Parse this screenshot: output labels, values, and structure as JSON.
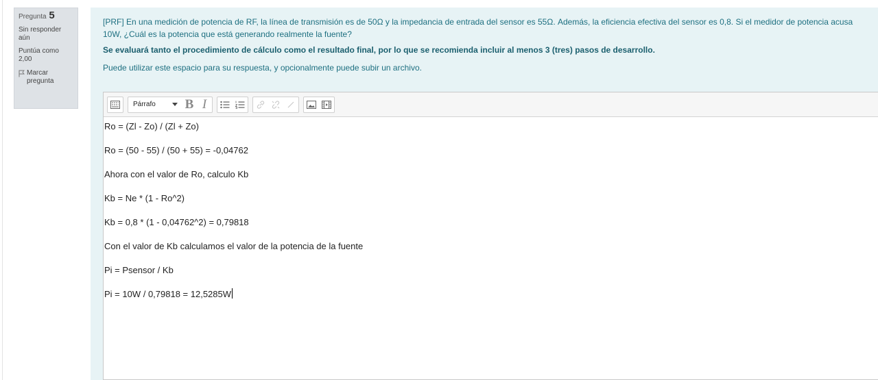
{
  "question_info": {
    "label": "Pregunta",
    "number": "5",
    "status": "Sin responder aún",
    "grade": "Puntúa como 2,00",
    "flag_label": "Marcar pregunta"
  },
  "question": {
    "text": "[PRF] En una medición de potencia de RF, la línea de transmisión es de 50Ω y la impedancia de entrada del sensor es 55Ω. Además, la eficiencia efectiva del sensor es 0,8. Si el medidor de potencia acusa 10W, ¿Cuál es la potencia que está generando realmente la fuente?",
    "instruction": "Se evaluará tanto el procedimiento de cálculo como el resultado final, por lo que se recomienda incluir al menos 3 (tres) pasos de desarrollo.",
    "hint": "Puede utilizar este espacio para su respuesta, y opcionalmente puede subir un archivo."
  },
  "toolbar": {
    "format_select": "Párrafo",
    "icons": [
      "toggle-toolbar-icon",
      "bold-icon",
      "italic-icon",
      "unordered-list-icon",
      "ordered-list-icon",
      "link-icon",
      "unlink-icon",
      "emoji-icon",
      "image-icon",
      "media-icon"
    ]
  },
  "answer": {
    "lines": [
      "Ro = (Zl - Zo) / (Zl + Zo)",
      "Ro = (50 - 55) / (50 + 55) = -0,04762",
      "Ahora con el valor de Ro, calculo Kb",
      "Kb = Ne * (1 - Ro^2)",
      "Kb = 0,8 * (1 - 0,04762^2) = 0,79818",
      "Con el valor de Kb calculamos el valor de la potencia de la fuente",
      "Pi = Psensor / Kb",
      "Pi = 10W / 0,79818 = 12,5285W"
    ]
  },
  "colors": {
    "info_bg": "#dee2e6",
    "content_bg": "#e7f3f5",
    "question_text": "#1d6f80"
  }
}
